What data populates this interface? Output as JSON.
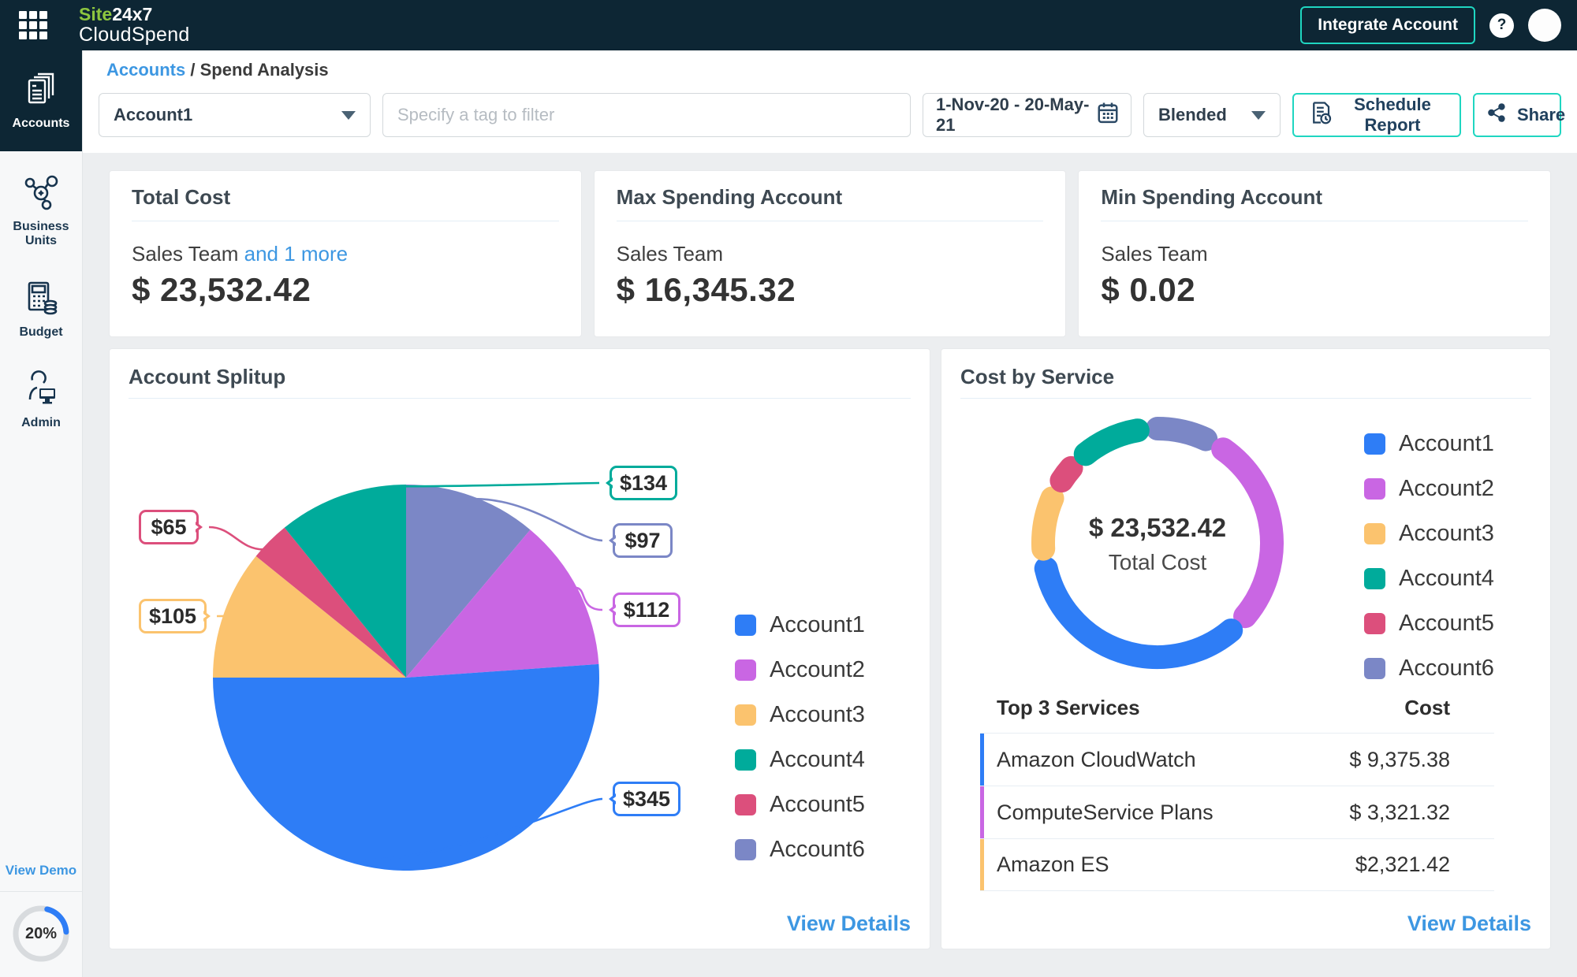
{
  "navbar": {
    "logo_green": "Site",
    "logo_white": "24x7",
    "logo_product": "CloudSpend",
    "integrate_button": "Integrate Account",
    "help_glyph": "?"
  },
  "sidebar": {
    "items": [
      {
        "label": "Accounts",
        "active": true
      },
      {
        "label": "Business Units",
        "active": false
      },
      {
        "label": "Budget",
        "active": false
      },
      {
        "label": "Admin",
        "active": false
      }
    ],
    "view_demo": "View Demo",
    "progress_percent": "20%"
  },
  "breadcrumb": {
    "parent": "Accounts",
    "separator": "/",
    "current": "Spend Analysis"
  },
  "filters": {
    "account_select_value": "Account1",
    "tag_placeholder": "Specify a tag to filter",
    "date_range": "1-Nov-20 - 20-May-21",
    "cost_type_value": "Blended",
    "schedule_report_label": "Schedule Report",
    "share_label": "Share"
  },
  "stat_cards": [
    {
      "title": "Total Cost",
      "entity": "Sales Team",
      "entity_more": "and 1 more",
      "value": "$ 23,532.42"
    },
    {
      "title": "Max Spending Account",
      "entity": "Sales Team",
      "entity_more": "",
      "value": "$ 16,345.32"
    },
    {
      "title": "Min Spending Account",
      "entity": "Sales Team",
      "entity_more": "",
      "value": "$ 0.02"
    }
  ],
  "account_splitup": {
    "title": "Account Splitup",
    "view_details": "View Details"
  },
  "cost_by_service": {
    "title": "Cost by Service",
    "center_value": "$ 23,532.42",
    "center_label": "Total Cost",
    "table_header_service": "Top 3 Services",
    "table_header_cost": "Cost",
    "view_details": "View Details"
  },
  "colors": {
    "navy": "#0d2634",
    "teal_accent": "#1fd6c1",
    "link_blue": "#3d97e2",
    "progress_blue": "#2e7df6"
  },
  "chart_data": [
    {
      "type": "pie",
      "title": "Account Splitup",
      "legend_position": "right",
      "angle_convention": "degrees clockwise from 12 o'clock as rendered on screen",
      "total_usd": 858,
      "slices": [
        {
          "label": "Account6",
          "value_usd": 97,
          "display": "$97",
          "color": "#7b87c6",
          "start_deg": 0,
          "end_deg": 40
        },
        {
          "label": "Account2",
          "value_usd": 112,
          "display": "$112",
          "color": "#c966e3",
          "start_deg": 40,
          "end_deg": 86
        },
        {
          "label": "Account1",
          "value_usd": 345,
          "display": "$345",
          "color": "#2e7df6",
          "start_deg": 86,
          "end_deg": 270
        },
        {
          "label": "Account3",
          "value_usd": 105,
          "display": "$105",
          "color": "#fbc36e",
          "start_deg": 270,
          "end_deg": 309
        },
        {
          "label": "Account5",
          "value_usd": 65,
          "display": "$65",
          "color": "#dc4f7c",
          "start_deg": 309,
          "end_deg": 321
        },
        {
          "label": "Account4",
          "value_usd": 134,
          "display": "$134",
          "color": "#00ab9b",
          "start_deg": 321,
          "end_deg": 360
        }
      ],
      "legend": [
        {
          "label": "Account1",
          "color": "#2e7df6"
        },
        {
          "label": "Account2",
          "color": "#c966e3"
        },
        {
          "label": "Account3",
          "color": "#fbc36e"
        },
        {
          "label": "Account4",
          "color": "#00ab9b"
        },
        {
          "label": "Account5",
          "color": "#dc4f7c"
        },
        {
          "label": "Account6",
          "color": "#7b87c6"
        }
      ]
    },
    {
      "type": "donut",
      "title": "Cost by Service",
      "center_value": "$ 23,532.42",
      "center_label": "Total Cost",
      "angle_convention": "degrees clockwise from 12 o'clock as rendered on screen; percentages estimated from pixels",
      "segments": [
        {
          "label": "Account6",
          "color": "#7b87c6",
          "start_deg": -5,
          "end_deg": 30,
          "approx_percent": 9.7
        },
        {
          "label": "Account2",
          "color": "#c966e3",
          "start_deg": 30,
          "end_deg": 135,
          "approx_percent": 29.2
        },
        {
          "label": "Account1",
          "color": "#2e7df6",
          "start_deg": 135,
          "end_deg": 262,
          "approx_percent": 35.3
        },
        {
          "label": "Account3",
          "color": "#fbc36e",
          "start_deg": 262,
          "end_deg": 298,
          "approx_percent": 10.0
        },
        {
          "label": "Account5",
          "color": "#dc4f7c",
          "start_deg": 298,
          "end_deg": 316,
          "approx_percent": 5.0
        },
        {
          "label": "Account4",
          "color": "#00ab9b",
          "start_deg": 316,
          "end_deg": 355,
          "approx_percent": 10.8
        }
      ],
      "legend": [
        {
          "label": "Account1",
          "color": "#2e7df6"
        },
        {
          "label": "Account2",
          "color": "#c966e3"
        },
        {
          "label": "Account3",
          "color": "#fbc36e"
        },
        {
          "label": "Account4",
          "color": "#00ab9b"
        },
        {
          "label": "Account5",
          "color": "#dc4f7c"
        },
        {
          "label": "Account6",
          "color": "#7b87c6"
        }
      ],
      "top_services": [
        {
          "service": "Amazon CloudWatch",
          "cost": "$ 9,375.38",
          "accent": "#2e7df6"
        },
        {
          "service": "ComputeService Plans",
          "cost": "$ 3,321.32",
          "accent": "#c966e3"
        },
        {
          "service": "Amazon ES",
          "cost": "$2,321.42",
          "accent": "#fbc36e"
        }
      ]
    }
  ]
}
